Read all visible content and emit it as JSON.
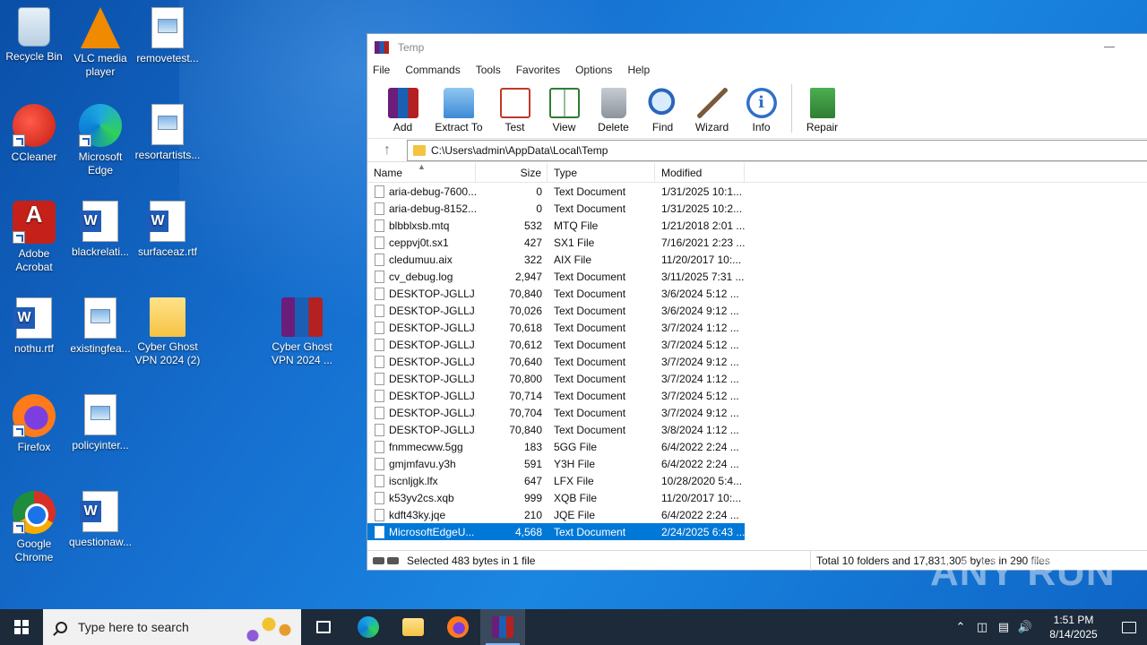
{
  "desktop": {
    "icons": [
      {
        "label": "Recycle Bin"
      },
      {
        "label": "VLC media player"
      },
      {
        "label": "removetest..."
      },
      {
        "label": "CCleaner"
      },
      {
        "label": "Microsoft Edge"
      },
      {
        "label": "resortartists..."
      },
      {
        "label": "Adobe Acrobat"
      },
      {
        "label": "blackrelati..."
      },
      {
        "label": "surfaceaz.rtf"
      },
      {
        "label": "nothu.rtf"
      },
      {
        "label": "existingfea..."
      },
      {
        "label": "Cyber Ghost VPN 2024 (2)"
      },
      {
        "label": "Cyber Ghost VPN 2024 ..."
      },
      {
        "label": "Firefox"
      },
      {
        "label": "policyinter..."
      },
      {
        "label": "Google Chrome"
      },
      {
        "label": "questionaw..."
      }
    ]
  },
  "window": {
    "title": "Temp",
    "menu": [
      "File",
      "Commands",
      "Tools",
      "Favorites",
      "Options",
      "Help"
    ],
    "toolbar": [
      "Add",
      "Extract To",
      "Test",
      "View",
      "Delete",
      "Find",
      "Wizard",
      "Info",
      "Repair"
    ],
    "path": "C:\\Users\\admin\\AppData\\Local\\Temp",
    "columns": {
      "name": "Name",
      "size": "Size",
      "type": "Type",
      "modified": "Modified"
    },
    "files": [
      {
        "name": "aria-debug-7600...",
        "size": "0",
        "type": "Text Document",
        "modified": "1/31/2025 10:1..."
      },
      {
        "name": "aria-debug-8152...",
        "size": "0",
        "type": "Text Document",
        "modified": "1/31/2025 10:2..."
      },
      {
        "name": "blbblxsb.mtq",
        "size": "532",
        "type": "MTQ File",
        "modified": "1/21/2018 2:01 ..."
      },
      {
        "name": "ceppvj0t.sx1",
        "size": "427",
        "type": "SX1 File",
        "modified": "7/16/2021 2:23 ..."
      },
      {
        "name": "cledumuu.aix",
        "size": "322",
        "type": "AIX File",
        "modified": "11/20/2017 10:..."
      },
      {
        "name": "cv_debug.log",
        "size": "2,947",
        "type": "Text Document",
        "modified": "3/11/2025 7:31 ..."
      },
      {
        "name": "DESKTOP-JGLLJ...",
        "size": "70,840",
        "type": "Text Document",
        "modified": "3/6/2024 5:12 ..."
      },
      {
        "name": "DESKTOP-JGLLJ...",
        "size": "70,026",
        "type": "Text Document",
        "modified": "3/6/2024 9:12 ..."
      },
      {
        "name": "DESKTOP-JGLLJ...",
        "size": "70,618",
        "type": "Text Document",
        "modified": "3/7/2024 1:12 ..."
      },
      {
        "name": "DESKTOP-JGLLJ...",
        "size": "70,612",
        "type": "Text Document",
        "modified": "3/7/2024 5:12 ..."
      },
      {
        "name": "DESKTOP-JGLLJ...",
        "size": "70,640",
        "type": "Text Document",
        "modified": "3/7/2024 9:12 ..."
      },
      {
        "name": "DESKTOP-JGLLJ...",
        "size": "70,800",
        "type": "Text Document",
        "modified": "3/7/2024 1:12 ..."
      },
      {
        "name": "DESKTOP-JGLLJ...",
        "size": "70,714",
        "type": "Text Document",
        "modified": "3/7/2024 5:12 ..."
      },
      {
        "name": "DESKTOP-JGLLJ...",
        "size": "70,704",
        "type": "Text Document",
        "modified": "3/7/2024 9:12 ..."
      },
      {
        "name": "DESKTOP-JGLLJ...",
        "size": "70,840",
        "type": "Text Document",
        "modified": "3/8/2024 1:12 ..."
      },
      {
        "name": "fnmmecww.5gg",
        "size": "183",
        "type": "5GG File",
        "modified": "6/4/2022 2:24 ..."
      },
      {
        "name": "gmjmfavu.y3h",
        "size": "591",
        "type": "Y3H File",
        "modified": "6/4/2022 2:24 ..."
      },
      {
        "name": "iscnljgk.lfx",
        "size": "647",
        "type": "LFX File",
        "modified": "10/28/2020 5:4..."
      },
      {
        "name": "k53yv2cs.xqb",
        "size": "999",
        "type": "XQB File",
        "modified": "11/20/2017 10:..."
      },
      {
        "name": "kdft43ky.jqe",
        "size": "210",
        "type": "JQE File",
        "modified": "6/4/2022 2:24 ..."
      },
      {
        "name": "MicrosoftEdgeU...",
        "size": "4,568",
        "type": "Text Document",
        "modified": "2/24/2025 6:43 ..."
      }
    ],
    "status_left": "Selected 483 bytes in 1 file",
    "status_right": "Total 10 folders and 17,831,305 bytes in 290 files"
  },
  "watermark": "ANY RUN",
  "taskbar": {
    "search_placeholder": "Type here to search",
    "time": "1:51 PM",
    "date": "8/14/2025"
  }
}
